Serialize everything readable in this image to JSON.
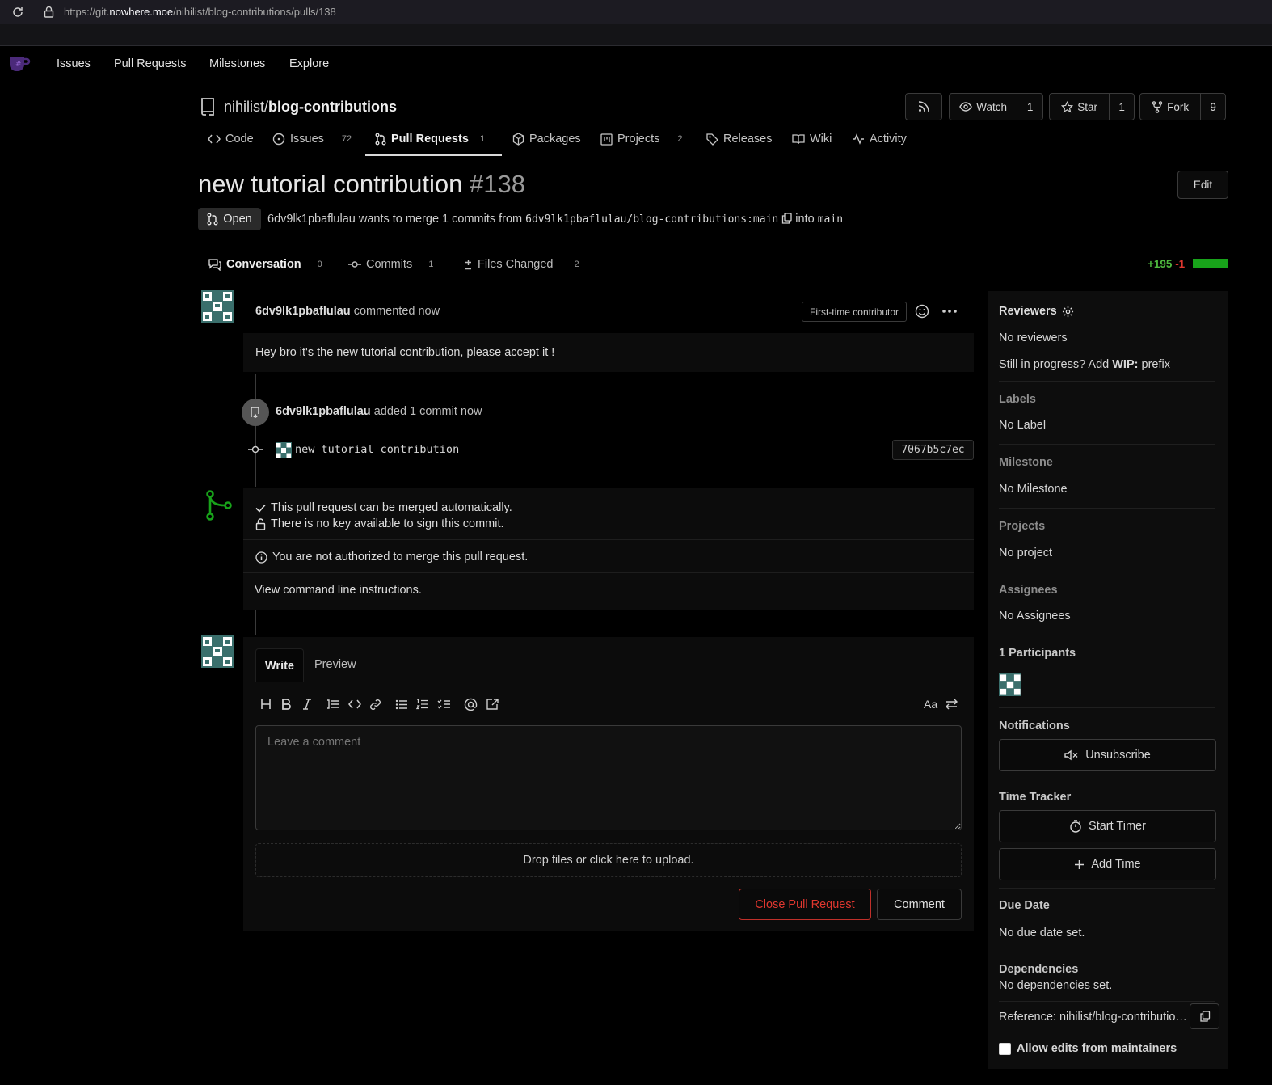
{
  "browser": {
    "url_prefix": "https://git.",
    "url_domain": "nowhere.moe",
    "url_path": "/nihilist/blog-contributions/pulls/138"
  },
  "topnav": {
    "items": [
      "Issues",
      "Pull Requests",
      "Milestones",
      "Explore"
    ]
  },
  "repo": {
    "owner": "nihilist",
    "sep": "/",
    "name": "blog-contributions",
    "watch_label": "Watch",
    "watch_count": "1",
    "star_label": "Star",
    "star_count": "1",
    "fork_label": "Fork",
    "fork_count": "9"
  },
  "repo_tabs": {
    "code": "Code",
    "issues": "Issues",
    "issues_count": "72",
    "pulls": "Pull Requests",
    "pulls_count": "1",
    "packages": "Packages",
    "projects": "Projects",
    "projects_count": "2",
    "releases": "Releases",
    "wiki": "Wiki",
    "activity": "Activity"
  },
  "pr": {
    "title": "new tutorial contribution",
    "number": "#138",
    "edit_label": "Edit",
    "state": "Open",
    "author": "6dv9lk1pbaflulau",
    "merge_text": "wants to merge 1 commits from",
    "head_branch": "6dv9lk1pbaflulau/blog-contributions:main",
    "into": "into",
    "base_branch": "main"
  },
  "pr_tabs": {
    "conversation": "Conversation",
    "conversation_count": "0",
    "commits": "Commits",
    "commits_count": "1",
    "files": "Files Changed",
    "files_count": "2",
    "additions": "+195",
    "deletions": "-1"
  },
  "comment": {
    "author": "6dv9lk1pbaflulau",
    "time": "commented now",
    "badge": "First-time contributor",
    "body": "Hey bro it's the new tutorial contribution, please accept it !"
  },
  "commit_event": {
    "author": "6dv9lk1pbaflulau",
    "text": "added 1 commit now",
    "message": "new tutorial contribution",
    "sha": "7067b5c7ec"
  },
  "merge_box": {
    "line1": "This pull request can be merged automatically.",
    "line2": "There is no key available to sign this commit.",
    "line3": "You are not authorized to merge this pull request.",
    "line4": "View command line instructions."
  },
  "editor": {
    "tab_write": "Write",
    "tab_preview": "Preview",
    "placeholder": "Leave a comment",
    "upload": "Drop files or click here to upload.",
    "close_btn": "Close Pull Request",
    "comment_btn": "Comment",
    "font_toggle": "Aa"
  },
  "sidebar": {
    "reviewers": "Reviewers",
    "no_reviewers": "No reviewers",
    "wip_pre": "Still in progress? Add",
    "wip_bold": "WIP:",
    "wip_post": "prefix",
    "labels": "Labels",
    "no_label": "No Label",
    "milestone": "Milestone",
    "no_milestone": "No Milestone",
    "projects": "Projects",
    "no_project": "No project",
    "assignees": "Assignees",
    "no_assignees": "No Assignees",
    "participants": "1 Participants",
    "notifications": "Notifications",
    "unsubscribe": "Unsubscribe",
    "time_tracker": "Time Tracker",
    "start_timer": "Start Timer",
    "add_time": "Add Time",
    "due_date": "Due Date",
    "no_due": "No due date set.",
    "dependencies": "Dependencies",
    "no_deps": "No dependencies set.",
    "reference": "Reference: nihilist/blog-contributio…",
    "allow_edits": "Allow edits from maintainers"
  },
  "colors": {
    "green": "#4eb83e",
    "red": "#e0372f",
    "accent_bar": "#18a31a"
  }
}
